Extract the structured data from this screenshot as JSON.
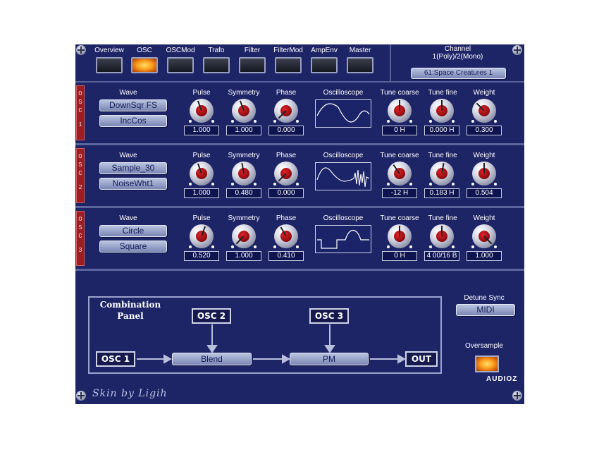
{
  "tabs": [
    {
      "label": "Overview",
      "active": false
    },
    {
      "label": "OSC",
      "active": true
    },
    {
      "label": "OSCMod",
      "active": false
    },
    {
      "label": "Trafo",
      "active": false
    },
    {
      "label": "Filter",
      "active": false
    },
    {
      "label": "FilterMod",
      "active": false
    },
    {
      "label": "AmpEnv",
      "active": false
    },
    {
      "label": "Master",
      "active": false
    }
  ],
  "channel": {
    "title": "Channel",
    "mode": "1(Poly)/2(Mono)",
    "preset": "61:Space Creatures 1"
  },
  "param_labels": {
    "wave": "Wave",
    "pulse": "Pulse",
    "symmetry": "Symmetry",
    "phase": "Phase",
    "oscilloscope": "Oscilloscope",
    "tune_coarse": "Tune coarse",
    "tune_fine": "Tune fine",
    "weight": "Weight"
  },
  "oscillators": [
    {
      "tag": [
        "O",
        "S",
        "C",
        "1"
      ],
      "wave1": "DownSqr FS",
      "wave2": "IncCos",
      "pulse": "1.000",
      "symmetry": "1.000",
      "phase": "0.000",
      "tune_coarse": "0 H",
      "tune_fine": "0.000 H",
      "weight": "0.300"
    },
    {
      "tag": [
        "O",
        "S",
        "C",
        "2"
      ],
      "wave1": "Sample_30",
      "wave2": "NoiseWht1",
      "pulse": "1.000",
      "symmetry": "0.480",
      "phase": "0.000",
      "tune_coarse": "-12 H",
      "tune_fine": "0.183 H",
      "weight": "0.504"
    },
    {
      "tag": [
        "O",
        "S",
        "C",
        "3"
      ],
      "wave1": "Circle",
      "wave2": "Square",
      "pulse": "0.520",
      "symmetry": "1.000",
      "phase": "0.410",
      "tune_coarse": "0 H",
      "tune_fine": "4 00/16 B",
      "weight": "1.000"
    }
  ],
  "combination": {
    "title_line1": "Combination",
    "title_line2": "Panel",
    "osc1": "OSC 1",
    "osc2": "OSC 2",
    "osc3": "OSC 3",
    "blend": "Blend",
    "pm": "PM",
    "out": "OUT"
  },
  "detune_sync": {
    "label": "Detune Sync",
    "value": "MIDI"
  },
  "oversample": {
    "label": "Oversample",
    "on": true
  },
  "footer": {
    "skin": "Skin by Ligih",
    "watermark": "AUDIOZ"
  },
  "colors": {
    "panel": "#1e2567",
    "accent_led": "#ff9d1c",
    "knob_cap": "#c0151b",
    "osc_tag": "#9c1e22"
  }
}
